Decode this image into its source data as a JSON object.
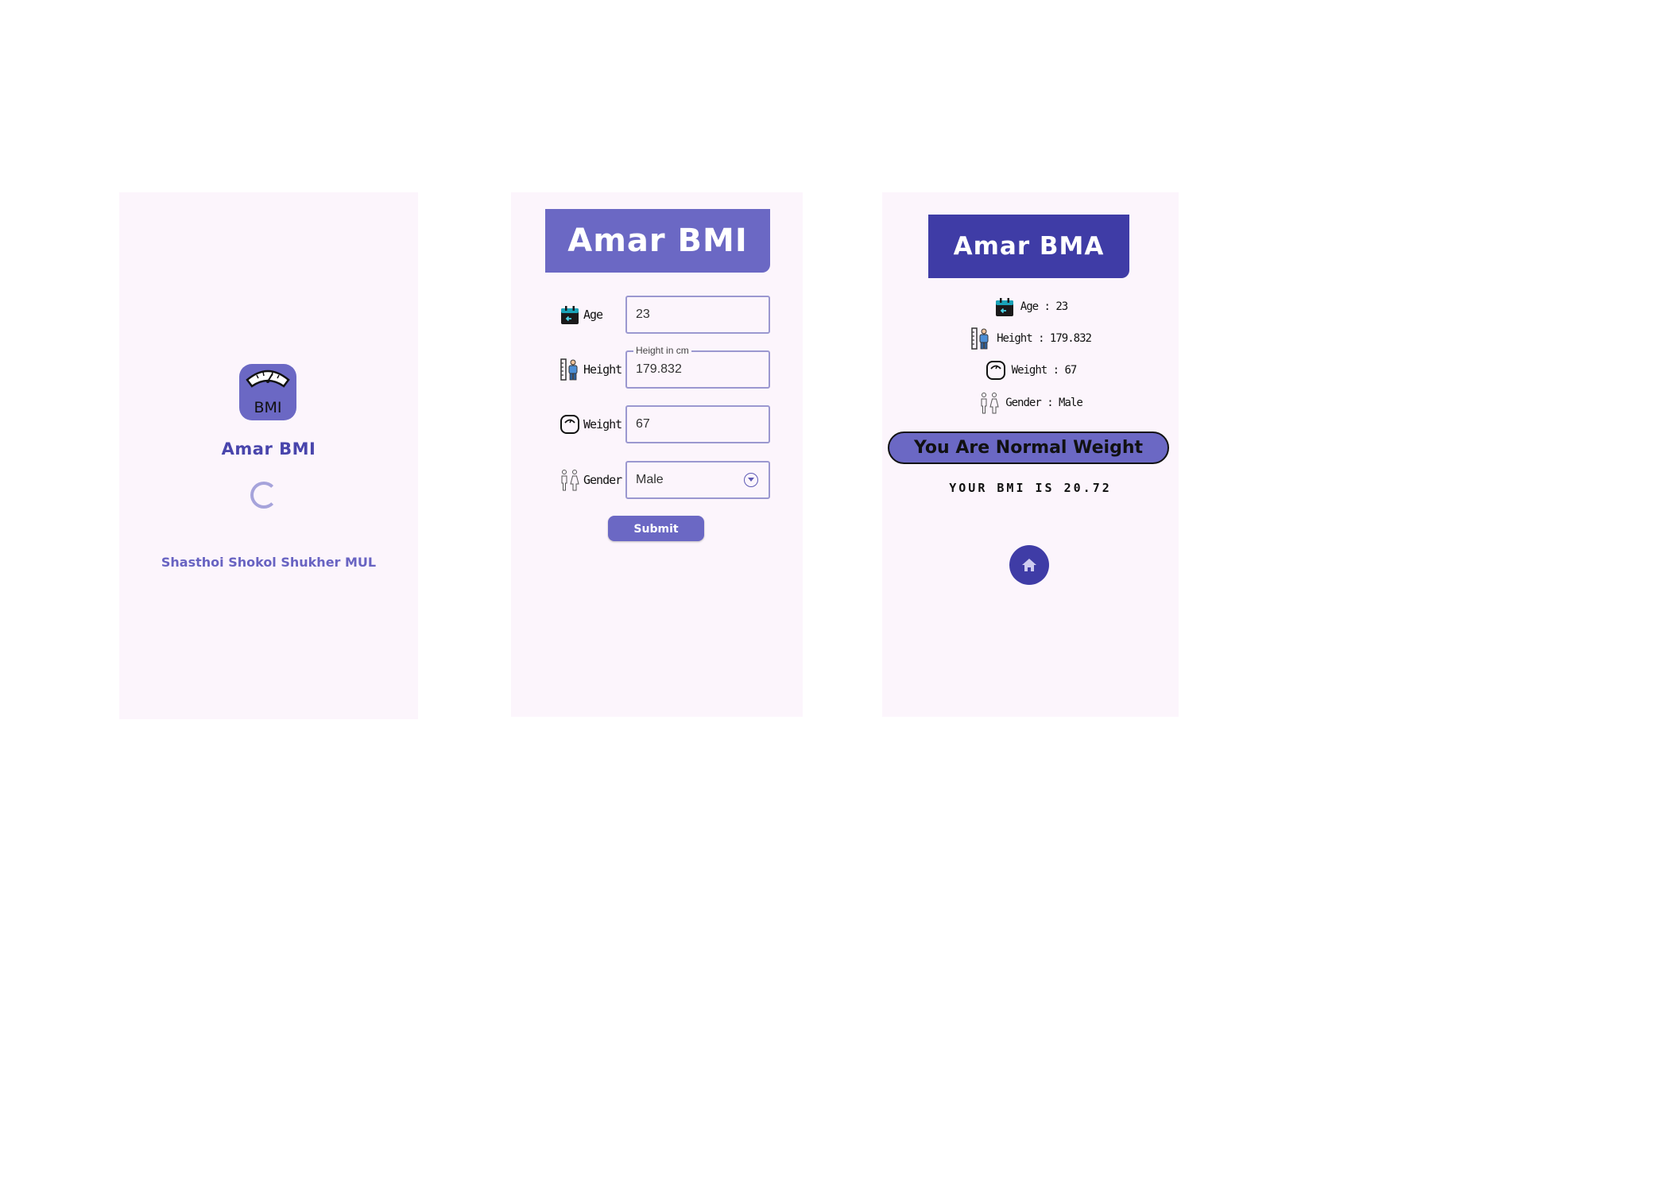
{
  "splash": {
    "logo_text": "BMI",
    "app_title": "Amar BMI",
    "tagline": "Shasthoi Shokol Shukher MUL"
  },
  "form": {
    "header_title": "Amar BMI",
    "age": {
      "label": "Age",
      "value": "23"
    },
    "height": {
      "label": "Height",
      "floating_label": "Height in cm",
      "value": "179.832"
    },
    "weight": {
      "label": "Weight",
      "value": "67"
    },
    "gender": {
      "label": "Gender",
      "selected": "Male"
    },
    "submit_label": "Submit"
  },
  "result": {
    "header_title": "Amar BMA",
    "age_text": "Age : 23",
    "height_text": "Height : 179.832",
    "weight_text": "Weight : 67",
    "gender_text": "Gender : Male",
    "status": "You Are Normal Weight",
    "bmi_text": "YOUR BMI IS 20.72"
  },
  "icons": {
    "age": "calendar-icon",
    "height": "height-measure-icon",
    "weight": "weighing-scale-icon",
    "gender": "gender-icon",
    "dropdown": "chevron-down-circle-icon",
    "home": "home-icon"
  },
  "colors": {
    "screen_background": "#fcf5fc",
    "primary": "#6b68c4",
    "primary_dark": "#3f3ca6",
    "accent_text": "#4945ac",
    "field_border": "#9b98d0"
  }
}
